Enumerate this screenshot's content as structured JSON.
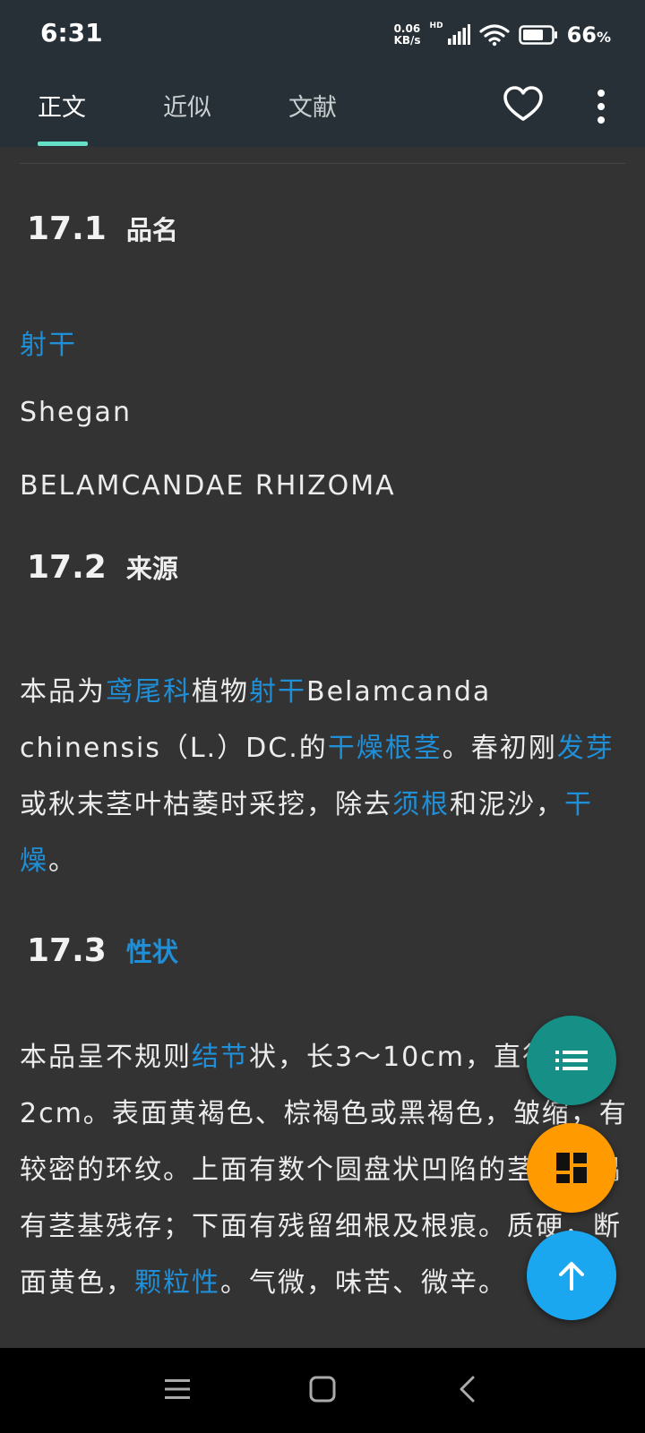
{
  "status": {
    "time": "6:31",
    "net_speed_value": "0.06",
    "net_speed_unit": "KB/s",
    "hd": "HD",
    "battery": "66",
    "battery_unit": "%"
  },
  "tabs": [
    {
      "label": "正文",
      "active": true
    },
    {
      "label": "近似",
      "active": false
    },
    {
      "label": "文献",
      "active": false
    }
  ],
  "icons": {
    "favorite": "heart-outline-icon",
    "more": "more-vertical-icon",
    "toc": "list-icon",
    "dashboard": "dashboard-icon",
    "top": "arrow-up-icon"
  },
  "colors": {
    "link": "#1f8fd8",
    "bar": "#263036",
    "background": "#333333",
    "tab_indicator": "#64e0c7"
  },
  "sections": {
    "s1": {
      "num": "17.1",
      "title": "品名"
    },
    "s2": {
      "num": "17.2",
      "title": "来源"
    },
    "s3": {
      "num": "17.3",
      "title": "性状"
    }
  },
  "name": {
    "cn": "射干",
    "pinyin": "Shegan",
    "latin": "BELAMCANDAE RHIZOMA"
  },
  "source": [
    {
      "text": "本品为",
      "link": false
    },
    {
      "text": "鸢尾科",
      "link": true
    },
    {
      "text": "植物",
      "link": false
    },
    {
      "text": "射干",
      "link": true
    },
    {
      "text": "Belamcanda chinensis（L.）DC.的",
      "link": false
    },
    {
      "text": "干燥根茎",
      "link": true
    },
    {
      "text": "。春初刚",
      "link": false
    },
    {
      "text": "发芽",
      "link": true
    },
    {
      "text": "或秋末茎叶枯萎时采挖，除去",
      "link": false
    },
    {
      "text": "须根",
      "link": true
    },
    {
      "text": "和泥沙，",
      "link": false
    },
    {
      "text": "干燥",
      "link": true
    },
    {
      "text": "。",
      "link": false
    }
  ],
  "character": [
    {
      "text": "本品呈不规则",
      "link": false
    },
    {
      "text": "结节",
      "link": true
    },
    {
      "text": "状，长3～10cm，直径1～2cm。表面黄褐色、棕褐色或黑褐色，皱缩，有较密的环纹。上面有数个圆盘状凹陷的茎痕，偶有茎基残存；下面有残留细根及根痕。质硬，断面黄色，",
      "link": false
    },
    {
      "text": "颗粒性",
      "link": true
    },
    {
      "text": "。气微，味苦、微辛。",
      "link": false
    }
  ]
}
